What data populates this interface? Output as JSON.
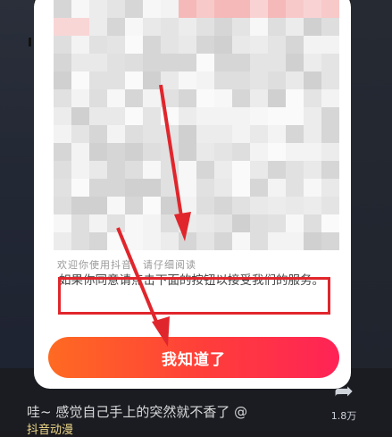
{
  "modal": {
    "partial_text": "欢迎你使用抖音，请仔细阅读",
    "consent_text": "如果你同意请点击下面的按钮以接受我们的服务。",
    "confirm_button": "我知道了"
  },
  "video": {
    "caption": "哇~ 感觉自己手上的突然就不香了 @",
    "author": "抖音动漫",
    "share_count": "1.8万",
    "share_icon": "share-arrow-icon"
  },
  "annotation": {
    "color": "#e0262c"
  },
  "colors": {
    "button_start": "#ff6a22",
    "button_end": "#ff2356"
  }
}
